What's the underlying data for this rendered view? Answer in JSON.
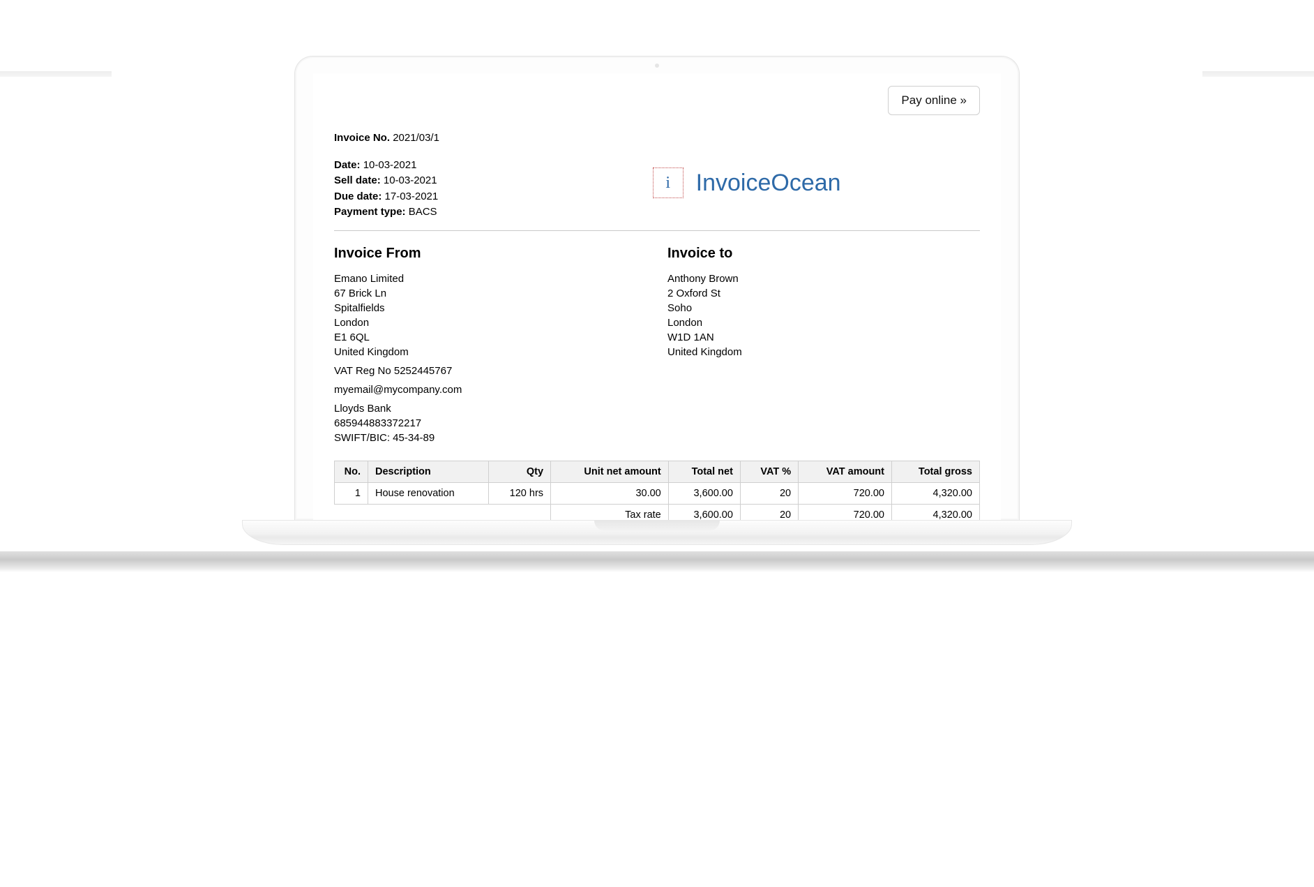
{
  "actions": {
    "pay_online": "Pay online »"
  },
  "brand": {
    "logo_letter": "i",
    "name": "InvoiceOcean"
  },
  "meta": {
    "invoice_no_label": "Invoice No.",
    "invoice_no": "2021/03/1",
    "date_label": "Date:",
    "date": "10-03-2021",
    "sell_date_label": "Sell date:",
    "sell_date": "10-03-2021",
    "due_date_label": "Due date:",
    "due_date": "17-03-2021",
    "payment_type_label": "Payment type:",
    "payment_type": "BACS"
  },
  "from": {
    "heading": "Invoice From",
    "name": "Emano Limited",
    "addr1": "67 Brick Ln",
    "addr2": "Spitalfields",
    "city": "London",
    "postcode": "E1 6QL",
    "country": "United Kingdom",
    "vat_label": "VAT Reg No",
    "vat": "5252445767",
    "email": "myemail@mycompany.com",
    "bank_name": "Lloyds Bank",
    "bank_account": "685944883372217",
    "swift_label": "SWIFT/BIC:",
    "swift": "45-34-89"
  },
  "to": {
    "heading": "Invoice to",
    "name": "Anthony Brown",
    "addr1": "2 Oxford St",
    "addr2": "Soho",
    "city": "London",
    "postcode": "W1D 1AN",
    "country": "United Kingdom"
  },
  "table": {
    "headers": {
      "no": "No.",
      "description": "Description",
      "qty": "Qty",
      "unit_net": "Unit net amount",
      "total_net": "Total net",
      "vat_pct": "VAT %",
      "vat_amount": "VAT amount",
      "total_gross": "Total gross"
    },
    "row1": {
      "no": "1",
      "description": "House renovation",
      "qty": "120 hrs",
      "unit_net": "30.00",
      "total_net": "3,600.00",
      "vat_pct": "20",
      "vat_amount": "720.00",
      "total_gross": "4,320.00"
    },
    "summary": {
      "label": "Tax rate",
      "total_net": "3,600.00",
      "vat_pct": "20",
      "vat_amount": "720.00",
      "total_gross": "4,320.00"
    }
  }
}
